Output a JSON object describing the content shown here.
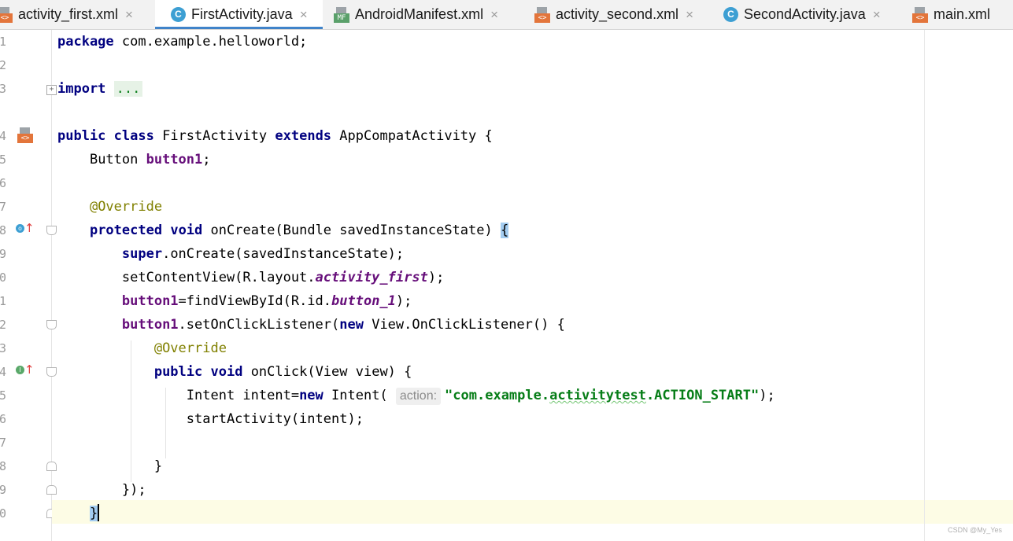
{
  "tabs": [
    {
      "label": "activity_first.xml",
      "icon": "xml-file-icon",
      "badge": "<>",
      "active": false
    },
    {
      "label": "FirstActivity.java",
      "icon": "java-class-icon",
      "badge": "C",
      "active": true
    },
    {
      "label": "AndroidManifest.xml",
      "icon": "manifest-file-icon",
      "badge": "MF",
      "active": false
    },
    {
      "label": "activity_second.xml",
      "icon": "xml-file-icon",
      "badge": "<>",
      "active": false
    },
    {
      "label": "SecondActivity.java",
      "icon": "java-class-icon",
      "badge": "C",
      "active": false
    },
    {
      "label": "main.xml",
      "icon": "xml-file-icon",
      "badge": "<>",
      "active": false
    }
  ],
  "close_glyph": "×",
  "line_numbers": [
    "1",
    "2",
    "3",
    "4",
    "5",
    "6",
    "7",
    "8",
    "9",
    "0",
    "1",
    "2",
    "3",
    "4",
    "5",
    "6",
    "7",
    "8",
    "9",
    "0"
  ],
  "code": {
    "l1": {
      "k_package": "package",
      "t_pkg": " com.example.helloworld;"
    },
    "l3": {
      "k_import": "import",
      "t_sp": " ",
      "f_dots": "..."
    },
    "l5": {
      "k_public": "public",
      "k_class": "class",
      "t_name": " FirstActivity ",
      "k_extends": "extends",
      "t_rest": " AppCompatActivity {"
    },
    "l6": {
      "t_type": "Button ",
      "f_field": "button1",
      "t_semi": ";"
    },
    "l8": {
      "a_override": "@Override"
    },
    "l9": {
      "k_protected": "protected",
      "k_void": "void",
      "t_sig": " onCreate(Bundle savedInstanceState) ",
      "b_brace": "{"
    },
    "l10": {
      "k_super": "super",
      "t_call": ".onCreate(savedInstanceState);"
    },
    "l11": {
      "t_a": "setContentView(R.layout.",
      "i_layout": "activity_first",
      "t_b": ");"
    },
    "l12": {
      "f_button1": "button1",
      "t_a": "=findViewById(R.id.",
      "i_id": "button_1",
      "t_b": ");"
    },
    "l13": {
      "f_button1": "button1",
      "t_a": ".setOnClickListener(",
      "k_new": "new",
      "t_b": " View.OnClickListener() {"
    },
    "l14": {
      "a_override": "@Override"
    },
    "l15": {
      "k_public": "public",
      "k_void": "void",
      "t_sig": " onClick(View view) {"
    },
    "l16": {
      "t_a": "Intent intent=",
      "k_new": "new",
      "t_b": " Intent( ",
      "h_param": "action:",
      "s_q1": "\"com.example.",
      "s_typo": "activitytest",
      "s_q2": ".ACTION_START\"",
      "t_c": ");"
    },
    "l17": {
      "t_call": "startActivity(intent);"
    },
    "l19": {
      "t_brace": "}"
    },
    "l20": {
      "t_close": "});"
    },
    "l21": {
      "t_brace": "}"
    }
  },
  "gutter_markers": {
    "class_layout_icon": "<>",
    "oncreate_marker": "o",
    "onclick_marker": "I"
  },
  "watermark": "CSDN @My_Yes",
  "colors": {
    "keyword": "#000080",
    "field": "#660e7a",
    "annotation": "#808000",
    "string": "#067d17",
    "current_line": "#fdfce5",
    "tab_active_underline": "#4083c9"
  }
}
